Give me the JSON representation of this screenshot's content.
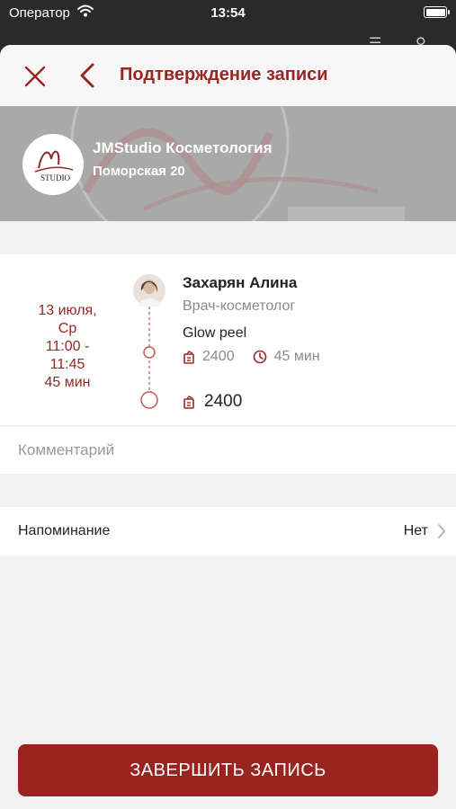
{
  "status_bar": {
    "carrier": "Оператор",
    "time": "13:54"
  },
  "nav": {
    "title": "Подтверждение записи"
  },
  "studio": {
    "name": "JMStudio Косметология",
    "address": "Поморская 20",
    "logo_text": "STUDIO"
  },
  "appointment": {
    "date_line1": "13 июля,",
    "date_line2": "Ср",
    "time_start": "11:00 -",
    "time_end": "11:45",
    "duration": "45 мин",
    "specialist_name": "Захарян Алина",
    "specialist_role": "Врач-косметолог",
    "service_name": "Glow peel",
    "service_price": "2400",
    "service_duration": "45 мин",
    "total": "2400"
  },
  "comment": {
    "placeholder": "Комментарий"
  },
  "reminder": {
    "label": "Напоминание",
    "value": "Нет"
  },
  "actions": {
    "finish_label": "ЗАВЕРШИТЬ ЗАПИСЬ"
  },
  "colors": {
    "accent": "#9a2624",
    "button": "#99231f",
    "banner": "#a9a9a9",
    "background": "#f1f1f1"
  }
}
